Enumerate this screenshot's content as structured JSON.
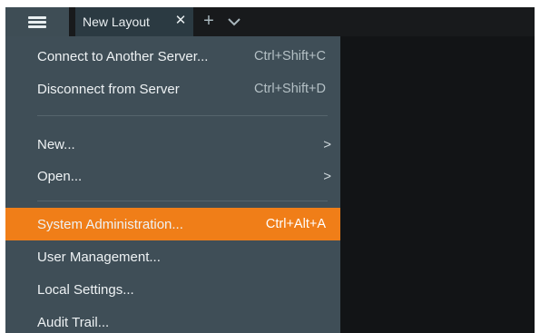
{
  "window": {
    "tabs": [
      {
        "label": "New Layout"
      }
    ]
  },
  "menu": {
    "items": [
      {
        "label": "Connect to Another Server...",
        "shortcut": "Ctrl+Shift+C"
      },
      {
        "label": "Disconnect from Server",
        "shortcut": "Ctrl+Shift+D"
      },
      {
        "label": "New...",
        "submenu_icon": "chevron-right-icon"
      },
      {
        "label": "Open...",
        "submenu_icon": "chevron-right-icon"
      },
      {
        "label": "System Administration...",
        "shortcut": "Ctrl+Alt+A",
        "highlighted": true
      },
      {
        "label": "User Management..."
      },
      {
        "label": "Local Settings..."
      },
      {
        "label": "Audit Trail..."
      }
    ]
  },
  "colors": {
    "menu_background": "#3f4e57",
    "highlight": "#f07e18",
    "tab_background": "#2b3a42",
    "workspace": "#121416"
  },
  "icons": {
    "main_menu": "hamburger-menu-icon",
    "tab_close": "close-icon",
    "add_tab": "plus-icon",
    "tabs_overflow": "chevron-down-icon"
  }
}
